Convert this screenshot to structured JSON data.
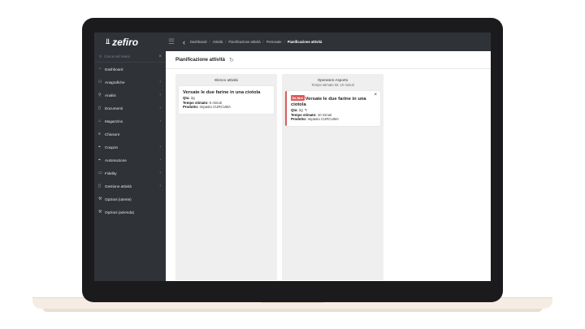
{
  "app": {
    "brand_name": "zefiro",
    "brand_glyph": "⫫"
  },
  "topbar": {
    "breadcrumb": [
      "Dashboard",
      "Attività",
      "Pianificazione attività",
      "Personale"
    ],
    "breadcrumb_current": "Pianificazione attività"
  },
  "sidebar": {
    "search_placeholder": "Cerca nel menù",
    "items": [
      {
        "label": "Dashboard",
        "icon": "dashboard-icon",
        "has_arrow": false
      },
      {
        "label": "Anagrafiche",
        "icon": "users-icon",
        "has_arrow": true
      },
      {
        "label": "Analisi",
        "icon": "search-icon",
        "has_arrow": true
      },
      {
        "label": "Documenti",
        "icon": "document-icon",
        "has_arrow": true
      },
      {
        "label": "Magazzino",
        "icon": "warehouse-icon",
        "has_arrow": true
      },
      {
        "label": "Chiusure",
        "icon": "list-icon",
        "has_arrow": false
      },
      {
        "label": "Coupon",
        "icon": "tag-icon",
        "has_arrow": true
      },
      {
        "label": "Automazione",
        "icon": "tag-icon",
        "has_arrow": true
      },
      {
        "label": "Fidelity",
        "icon": "card-icon",
        "has_arrow": true
      },
      {
        "label": "Gestione attività",
        "icon": "document-icon",
        "has_arrow": true
      },
      {
        "label": "Opzioni (utente)",
        "icon": "wrench-icon",
        "has_arrow": false
      },
      {
        "label": "Opzioni (azienda)",
        "icon": "wrench-icon",
        "has_arrow": false
      }
    ]
  },
  "main": {
    "title": "Pianificazione attività",
    "columns": [
      {
        "title": "Elenco attività",
        "subtitle": "",
        "card": {
          "badge": "",
          "title": "Versate le due farine in una ciotola",
          "qta_label": "Qta:",
          "qta_value": "2g",
          "tempo_label": "Tempo stimato:",
          "tempo_value": "5 minuti",
          "prodotto_label": "Prodotto:",
          "prodotto_value": "Impasto CURCUMA"
        }
      },
      {
        "title": "Operatore Asporto",
        "subtitle": "Tempo stimato tot: 10 minuti",
        "card": {
          "badge": "Da fare",
          "title": "Versate le due farine in una ciotola",
          "qta_label": "Qta:",
          "qta_value": "2g",
          "tempo_label": "Tempo stimato:",
          "tempo_value": "10 minuti",
          "prodotto_label": "Prodotto:",
          "prodotto_value": "Impasto CURCUMA"
        }
      }
    ]
  },
  "colors": {
    "sidebar_bg": "#2f3237",
    "badge_red": "#e05a5a",
    "column_bg": "#efefef"
  }
}
